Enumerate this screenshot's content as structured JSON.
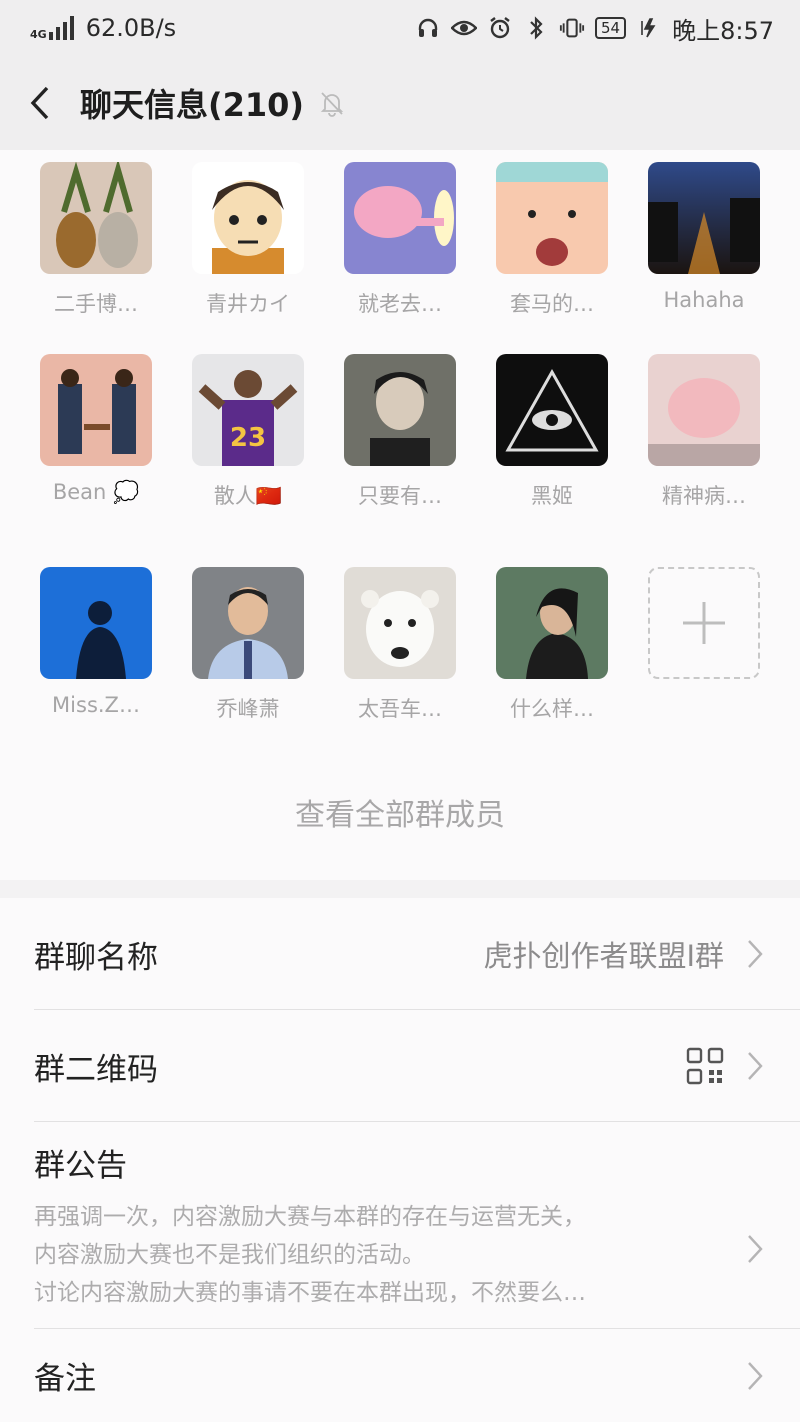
{
  "status_bar": {
    "network_type": "4G",
    "speed": "62.0B/s",
    "battery": "54",
    "time": "晚上8:57"
  },
  "header": {
    "title": "聊天信息(210)",
    "back_icon": "chevron-left-icon",
    "mute_icon": "bell-off-icon"
  },
  "members": [
    {
      "name": "二手博…",
      "avatar": "pineapple"
    },
    {
      "name": "青井カイ",
      "avatar": "anime-boy"
    },
    {
      "name": "就老去…",
      "avatar": "pink-cartoon"
    },
    {
      "name": "套马的…",
      "avatar": "cartoon-face"
    },
    {
      "name": "Hahaha",
      "avatar": "night-road"
    },
    {
      "name": "Bean 💭",
      "avatar": "two-men"
    },
    {
      "name": "散人🇨🇳",
      "avatar": "basketball-player"
    },
    {
      "name": "只要有…",
      "avatar": "young-man"
    },
    {
      "name": "黑姬",
      "avatar": "eye-triangle"
    },
    {
      "name": "精神病…",
      "avatar": "pink-meme"
    },
    {
      "name": "Miss.Z…",
      "avatar": "silhouette-blue"
    },
    {
      "name": "乔峰萧",
      "avatar": "man-portrait"
    },
    {
      "name": "太吾车…",
      "avatar": "polar-bear"
    },
    {
      "name": "什么样…",
      "avatar": "long-hair-man"
    }
  ],
  "view_all": "查看全部群成员",
  "settings": {
    "group_name_label": "群聊名称",
    "group_name_value": "虎扑创作者联盟I群",
    "qr_label": "群二维码",
    "notice_label": "群公告",
    "notice_lines": [
      "再强调一次，内容激励大赛与本群的存在与运营无关，",
      "内容激励大赛也不是我们组织的活动。",
      "讨论内容激励大赛的事请不要在本群出现，不然要么…"
    ],
    "remark_label": "备注"
  },
  "colors": {
    "bar_bg": "#efeeef",
    "panel_bg": "#fbfafb",
    "muted_text": "#a6a5a6"
  }
}
